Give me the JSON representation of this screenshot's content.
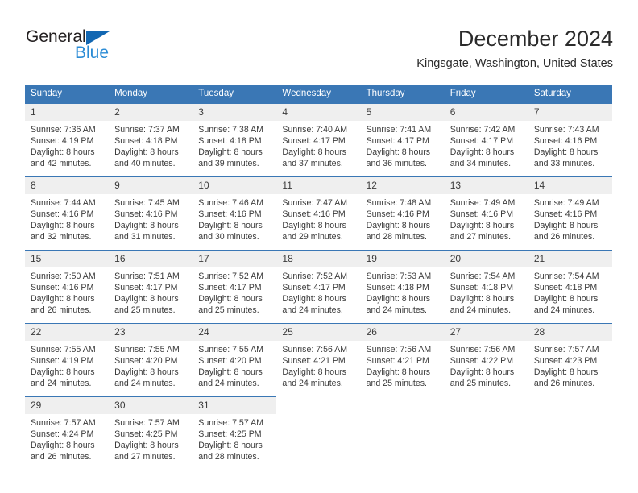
{
  "brand": {
    "name_part1": "General",
    "name_part2": "Blue",
    "triangle_icon": "triangle-icon",
    "color_dark": "#231f20",
    "color_blue": "#2a8bd5",
    "color_triangle": "#1267b2"
  },
  "header": {
    "title": "December 2024",
    "subtitle": "Kingsgate, Washington, United States"
  },
  "theme": {
    "header_bg": "#3a77b5",
    "daynum_bg": "#efefef",
    "text": "#3b3b3b"
  },
  "weekdays": [
    "Sunday",
    "Monday",
    "Tuesday",
    "Wednesday",
    "Thursday",
    "Friday",
    "Saturday"
  ],
  "weeks": [
    [
      {
        "day": "1",
        "sunrise": "Sunrise: 7:36 AM",
        "sunset": "Sunset: 4:19 PM",
        "daylight1": "Daylight: 8 hours",
        "daylight2": "and 42 minutes."
      },
      {
        "day": "2",
        "sunrise": "Sunrise: 7:37 AM",
        "sunset": "Sunset: 4:18 PM",
        "daylight1": "Daylight: 8 hours",
        "daylight2": "and 40 minutes."
      },
      {
        "day": "3",
        "sunrise": "Sunrise: 7:38 AM",
        "sunset": "Sunset: 4:18 PM",
        "daylight1": "Daylight: 8 hours",
        "daylight2": "and 39 minutes."
      },
      {
        "day": "4",
        "sunrise": "Sunrise: 7:40 AM",
        "sunset": "Sunset: 4:17 PM",
        "daylight1": "Daylight: 8 hours",
        "daylight2": "and 37 minutes."
      },
      {
        "day": "5",
        "sunrise": "Sunrise: 7:41 AM",
        "sunset": "Sunset: 4:17 PM",
        "daylight1": "Daylight: 8 hours",
        "daylight2": "and 36 minutes."
      },
      {
        "day": "6",
        "sunrise": "Sunrise: 7:42 AM",
        "sunset": "Sunset: 4:17 PM",
        "daylight1": "Daylight: 8 hours",
        "daylight2": "and 34 minutes."
      },
      {
        "day": "7",
        "sunrise": "Sunrise: 7:43 AM",
        "sunset": "Sunset: 4:16 PM",
        "daylight1": "Daylight: 8 hours",
        "daylight2": "and 33 minutes."
      }
    ],
    [
      {
        "day": "8",
        "sunrise": "Sunrise: 7:44 AM",
        "sunset": "Sunset: 4:16 PM",
        "daylight1": "Daylight: 8 hours",
        "daylight2": "and 32 minutes."
      },
      {
        "day": "9",
        "sunrise": "Sunrise: 7:45 AM",
        "sunset": "Sunset: 4:16 PM",
        "daylight1": "Daylight: 8 hours",
        "daylight2": "and 31 minutes."
      },
      {
        "day": "10",
        "sunrise": "Sunrise: 7:46 AM",
        "sunset": "Sunset: 4:16 PM",
        "daylight1": "Daylight: 8 hours",
        "daylight2": "and 30 minutes."
      },
      {
        "day": "11",
        "sunrise": "Sunrise: 7:47 AM",
        "sunset": "Sunset: 4:16 PM",
        "daylight1": "Daylight: 8 hours",
        "daylight2": "and 29 minutes."
      },
      {
        "day": "12",
        "sunrise": "Sunrise: 7:48 AM",
        "sunset": "Sunset: 4:16 PM",
        "daylight1": "Daylight: 8 hours",
        "daylight2": "and 28 minutes."
      },
      {
        "day": "13",
        "sunrise": "Sunrise: 7:49 AM",
        "sunset": "Sunset: 4:16 PM",
        "daylight1": "Daylight: 8 hours",
        "daylight2": "and 27 minutes."
      },
      {
        "day": "14",
        "sunrise": "Sunrise: 7:49 AM",
        "sunset": "Sunset: 4:16 PM",
        "daylight1": "Daylight: 8 hours",
        "daylight2": "and 26 minutes."
      }
    ],
    [
      {
        "day": "15",
        "sunrise": "Sunrise: 7:50 AM",
        "sunset": "Sunset: 4:16 PM",
        "daylight1": "Daylight: 8 hours",
        "daylight2": "and 26 minutes."
      },
      {
        "day": "16",
        "sunrise": "Sunrise: 7:51 AM",
        "sunset": "Sunset: 4:17 PM",
        "daylight1": "Daylight: 8 hours",
        "daylight2": "and 25 minutes."
      },
      {
        "day": "17",
        "sunrise": "Sunrise: 7:52 AM",
        "sunset": "Sunset: 4:17 PM",
        "daylight1": "Daylight: 8 hours",
        "daylight2": "and 25 minutes."
      },
      {
        "day": "18",
        "sunrise": "Sunrise: 7:52 AM",
        "sunset": "Sunset: 4:17 PM",
        "daylight1": "Daylight: 8 hours",
        "daylight2": "and 24 minutes."
      },
      {
        "day": "19",
        "sunrise": "Sunrise: 7:53 AM",
        "sunset": "Sunset: 4:18 PM",
        "daylight1": "Daylight: 8 hours",
        "daylight2": "and 24 minutes."
      },
      {
        "day": "20",
        "sunrise": "Sunrise: 7:54 AM",
        "sunset": "Sunset: 4:18 PM",
        "daylight1": "Daylight: 8 hours",
        "daylight2": "and 24 minutes."
      },
      {
        "day": "21",
        "sunrise": "Sunrise: 7:54 AM",
        "sunset": "Sunset: 4:18 PM",
        "daylight1": "Daylight: 8 hours",
        "daylight2": "and 24 minutes."
      }
    ],
    [
      {
        "day": "22",
        "sunrise": "Sunrise: 7:55 AM",
        "sunset": "Sunset: 4:19 PM",
        "daylight1": "Daylight: 8 hours",
        "daylight2": "and 24 minutes."
      },
      {
        "day": "23",
        "sunrise": "Sunrise: 7:55 AM",
        "sunset": "Sunset: 4:20 PM",
        "daylight1": "Daylight: 8 hours",
        "daylight2": "and 24 minutes."
      },
      {
        "day": "24",
        "sunrise": "Sunrise: 7:55 AM",
        "sunset": "Sunset: 4:20 PM",
        "daylight1": "Daylight: 8 hours",
        "daylight2": "and 24 minutes."
      },
      {
        "day": "25",
        "sunrise": "Sunrise: 7:56 AM",
        "sunset": "Sunset: 4:21 PM",
        "daylight1": "Daylight: 8 hours",
        "daylight2": "and 24 minutes."
      },
      {
        "day": "26",
        "sunrise": "Sunrise: 7:56 AM",
        "sunset": "Sunset: 4:21 PM",
        "daylight1": "Daylight: 8 hours",
        "daylight2": "and 25 minutes."
      },
      {
        "day": "27",
        "sunrise": "Sunrise: 7:56 AM",
        "sunset": "Sunset: 4:22 PM",
        "daylight1": "Daylight: 8 hours",
        "daylight2": "and 25 minutes."
      },
      {
        "day": "28",
        "sunrise": "Sunrise: 7:57 AM",
        "sunset": "Sunset: 4:23 PM",
        "daylight1": "Daylight: 8 hours",
        "daylight2": "and 26 minutes."
      }
    ],
    [
      {
        "day": "29",
        "sunrise": "Sunrise: 7:57 AM",
        "sunset": "Sunset: 4:24 PM",
        "daylight1": "Daylight: 8 hours",
        "daylight2": "and 26 minutes."
      },
      {
        "day": "30",
        "sunrise": "Sunrise: 7:57 AM",
        "sunset": "Sunset: 4:25 PM",
        "daylight1": "Daylight: 8 hours",
        "daylight2": "and 27 minutes."
      },
      {
        "day": "31",
        "sunrise": "Sunrise: 7:57 AM",
        "sunset": "Sunset: 4:25 PM",
        "daylight1": "Daylight: 8 hours",
        "daylight2": "and 28 minutes."
      },
      null,
      null,
      null,
      null
    ]
  ]
}
